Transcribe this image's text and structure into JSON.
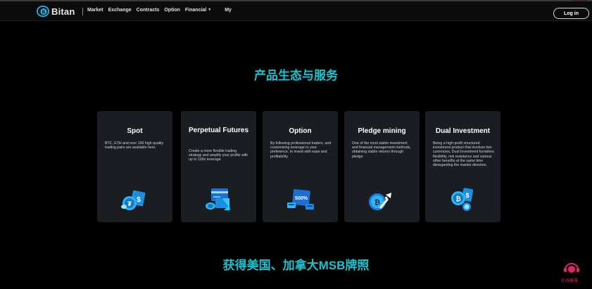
{
  "brand": {
    "name": "Bitan"
  },
  "nav": {
    "items": [
      "Market",
      "Exchange",
      "Contracts",
      "Option",
      "Financial"
    ],
    "my": "My",
    "login": "Log in"
  },
  "sections": {
    "products_heading": "产品生态与服务",
    "license_heading": "获得美国、加拿大MSB牌照"
  },
  "cards": [
    {
      "title": "Spot",
      "desc": "BTC, ETH and over 100 high quality trading pairs are available here.",
      "icon": "coins-dollar-icon"
    },
    {
      "title": "Perpetual Futures",
      "desc": "Create a more flexible trading strategy and amplify your profits with up to 100x leverage.",
      "icon": "card-coin-icon"
    },
    {
      "title": "Option",
      "desc": "By following professional traders, and customizing leverage to your preference, to invest with ease and profitability.",
      "icon": "option-500-icon"
    },
    {
      "title": "Pledge mining",
      "desc": "One of the most stable investment and financial management methods, obtaining stable returns through pledge",
      "icon": "pledge-arrow-icon"
    },
    {
      "title": "Dual Investment",
      "desc": "Being a high-profit structured investment product that involves two currencies, Dual Investment furnishes flexibility, risk resistance and various other benefits at the same time disregarding the market direction.",
      "icon": "dual-coins-icon"
    }
  ],
  "chat": {
    "label": "在线客服"
  },
  "colors": {
    "accent": "#19c3cf",
    "card_bg": "#1a1d22",
    "background": "#000000",
    "chat": "#e0246a"
  }
}
